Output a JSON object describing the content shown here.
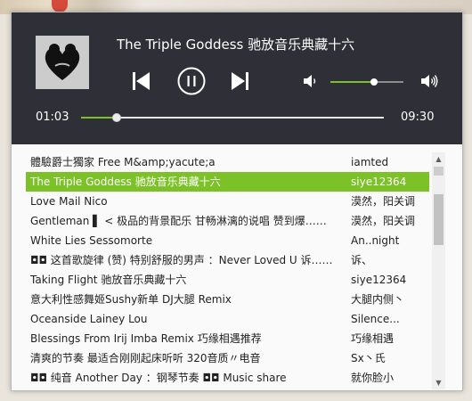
{
  "player": {
    "track_title": "The Triple Goddess 驰放音乐典藏十六",
    "current_time": "01:03",
    "total_time": "09:30",
    "progress": 0.117,
    "volume": 0.6,
    "accent_color": "#7cc127",
    "controls": {
      "prev_icon": "previous-icon",
      "play_icon": "pause-icon",
      "next_icon": "next-icon",
      "volume_low_icon": "volume-low-icon",
      "volume_high_icon": "volume-high-icon"
    }
  },
  "playlist": {
    "active_index": 1,
    "rows": [
      {
        "title": "體驗爵士獨家 Free M&amp;yacute;a",
        "artist": "iamted"
      },
      {
        "title": "The Triple Goddess 驰放音乐典藏十六",
        "artist": "siye12364"
      },
      {
        "title": "Love Mail Nico",
        "artist": "漠然，阳关调"
      },
      {
        "title": "Gentleman ▌ < 极品的背景配乐 甘畅淋漓的说唱 赞到爆……",
        "artist": "漠然，阳关调"
      },
      {
        "title": "White Lies Sessomorte",
        "artist": "An..night"
      },
      {
        "title": "◘◘ 这首歌旋律 (赞) 特别舒服的男声 ：Never Loved U 诉……",
        "artist": "诉、"
      },
      {
        "title": "Taking Flight 驰放音乐典藏十六",
        "artist": "siye12364"
      },
      {
        "title": "意大利性感舞姬Sushy新单 DJ大腿 Remix",
        "artist": "大腿内侧丶"
      },
      {
        "title": "Oceanside Lainey Lou",
        "artist": "Silence..."
      },
      {
        "title": "Blessings From Irij Imba Remix 巧缘相遇推荐",
        "artist": "巧缘相遇"
      },
      {
        "title": "清爽的节奏 最适合刚刚起床听听 320音质〃电音",
        "artist": "Sx丶氏"
      },
      {
        "title": "◘◘ 纯音 Another Day ：钢琴节奏 ◘◘ Music share",
        "artist": "就你脸小"
      }
    ]
  },
  "scrollbar": {
    "up_icon": "scroll-up-arrow-icon",
    "down_icon": "scroll-down-arrow-icon"
  }
}
